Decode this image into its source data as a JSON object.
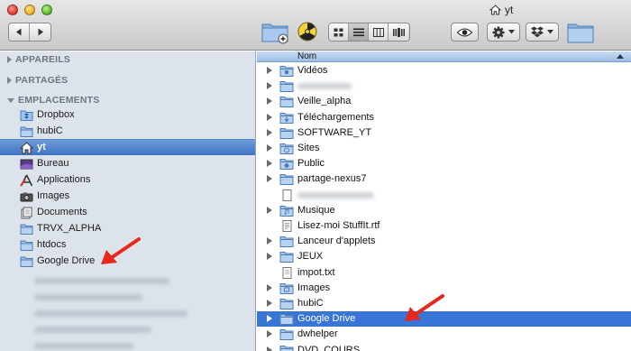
{
  "window": {
    "title": "yt"
  },
  "toolbar": {
    "nav": [
      "back-icon",
      "forward-icon"
    ],
    "new_folder_icon": "folder-plus-icon",
    "burn_icon": "burn-icon",
    "views": [
      "icon-view-icon",
      "list-view-icon",
      "column-view-icon",
      "coverflow-view-icon"
    ],
    "active_view": 1,
    "quicklook_icon": "eye-icon",
    "action_icon": "gear-icon",
    "dropbox_icon": "dropbox-icon",
    "path_icon": "folder-icon"
  },
  "sidebar": {
    "sections": [
      {
        "label": "APPAREILS",
        "expanded": false
      },
      {
        "label": "PARTAGÉS",
        "expanded": false
      },
      {
        "label": "EMPLACEMENTS",
        "expanded": true
      }
    ],
    "items": [
      {
        "label": "Dropbox",
        "icon": "dropbox-folder-icon"
      },
      {
        "label": "hubiC",
        "icon": "folder-icon"
      },
      {
        "label": "yt",
        "icon": "home-icon",
        "selected": true
      },
      {
        "label": "Bureau",
        "icon": "desktop-icon"
      },
      {
        "label": "Applications",
        "icon": "applications-icon"
      },
      {
        "label": "Images",
        "icon": "camera-icon"
      },
      {
        "label": "Documents",
        "icon": "documents-icon"
      },
      {
        "label": "TRVX_ALPHA",
        "icon": "folder-icon"
      },
      {
        "label": "htdocs",
        "icon": "folder-icon"
      },
      {
        "label": "Google Drive",
        "icon": "folder-icon"
      }
    ]
  },
  "list": {
    "column_header": "Nom",
    "rows": [
      {
        "label": "Vidéos",
        "icon": "movies-folder-icon",
        "expandable": true
      },
      {
        "label": "",
        "icon": "folder-icon",
        "expandable": true,
        "blurred": true
      },
      {
        "label": "Veille_alpha",
        "icon": "folder-icon",
        "expandable": true
      },
      {
        "label": "Téléchargements",
        "icon": "downloads-folder-icon",
        "expandable": true
      },
      {
        "label": "SOFTWARE_YT",
        "icon": "folder-icon",
        "expandable": true
      },
      {
        "label": "Sites",
        "icon": "sites-folder-icon",
        "expandable": true
      },
      {
        "label": "Public",
        "icon": "public-folder-icon",
        "expandable": true
      },
      {
        "label": "partage-nexus7",
        "icon": "folder-icon",
        "expandable": true
      },
      {
        "label": "",
        "icon": "file-icon",
        "expandable": false,
        "blurred": true
      },
      {
        "label": "Musique",
        "icon": "music-folder-icon",
        "expandable": true
      },
      {
        "label": "Lisez-moi StuffIt.rtf",
        "icon": "document-icon",
        "expandable": false
      },
      {
        "label": "Lanceur d'applets",
        "icon": "folder-icon",
        "expandable": true
      },
      {
        "label": "JEUX",
        "icon": "folder-icon",
        "expandable": true
      },
      {
        "label": "impot.txt",
        "icon": "text-file-icon",
        "expandable": false
      },
      {
        "label": "Images",
        "icon": "pictures-folder-icon",
        "expandable": true
      },
      {
        "label": "hubiC",
        "icon": "folder-icon",
        "expandable": true
      },
      {
        "label": "Google Drive",
        "icon": "folder-icon",
        "expandable": true,
        "selected": true
      },
      {
        "label": "dwhelper",
        "icon": "folder-icon",
        "expandable": true
      },
      {
        "label": "DVD_COURS",
        "icon": "folder-icon",
        "expandable": true
      }
    ]
  },
  "colors": {
    "selection": "#3875d7",
    "sidebar_bg": "#dde3ea",
    "arrow": "#e8281c"
  }
}
